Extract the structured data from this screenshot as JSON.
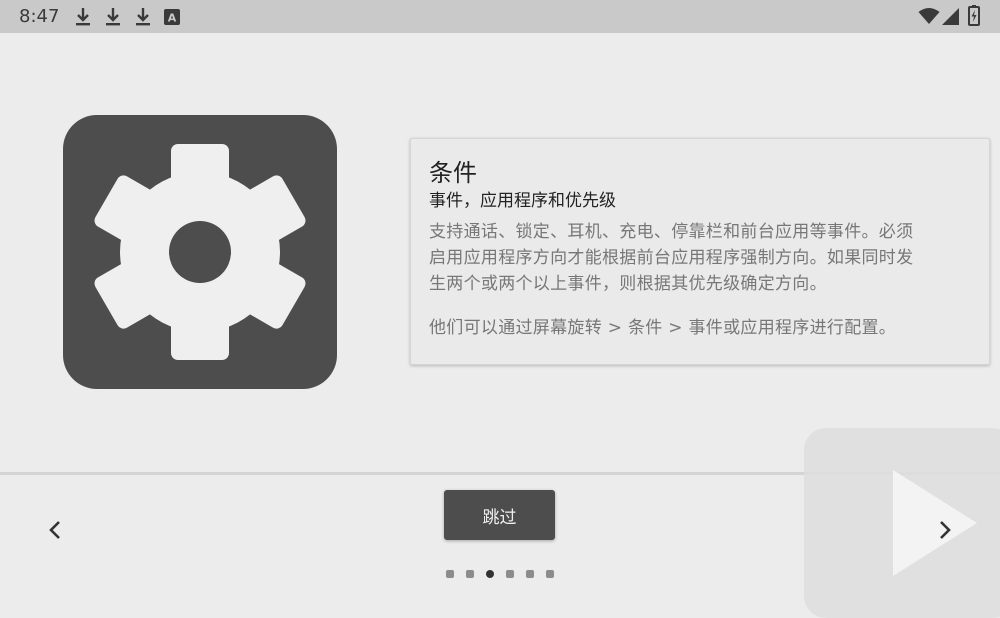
{
  "status_bar": {
    "time": "8:47",
    "left_icons": [
      "download-icon",
      "download-icon",
      "download-icon",
      "font-a-icon"
    ],
    "right_icons": [
      "wifi-icon",
      "cell-signal-icon",
      "battery-charging-icon"
    ],
    "font_icon_letter": "A"
  },
  "onboarding": {
    "icon": "gear-icon",
    "card": {
      "title": "条件",
      "subtitle": "事件，应用程序和优先级",
      "description_lines": [
        "支持通话、锁定、耳机、充电、停靠栏和前台应用等事件。必须",
        "启用应用程序方向才能根据前台应用程序强制方向。如果同时发",
        "生两个或两个以上事件，则根据其优先级确定方向。"
      ],
      "note": "他们可以通过屏幕旋转 > 条件 > 事件或应用程序进行配置。"
    }
  },
  "navigation": {
    "skip_label": "跳过",
    "prev_icon": "chevron-left-icon",
    "next_icon": "chevron-right-icon",
    "overlay_icon": "play-triangle-icon",
    "page_count": 6,
    "current_page": 3
  },
  "colors": {
    "background": "#ececec",
    "status_bar": "#c9c9c9",
    "tile": "#4d4d4d",
    "gear": "#efefef",
    "button": "#4d4d4d",
    "dot_active": "#333333",
    "dot_inactive": "#8c8c8c"
  }
}
